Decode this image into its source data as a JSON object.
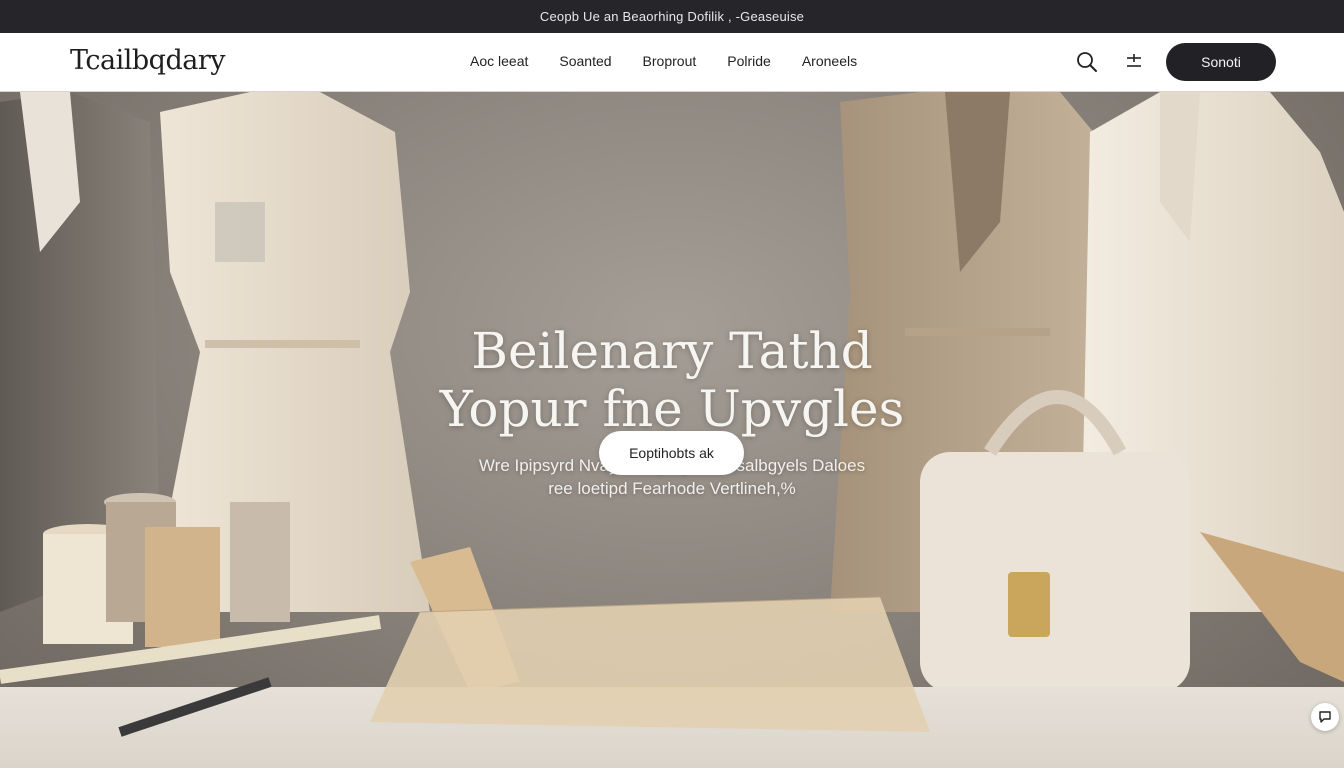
{
  "announcement": "Ceopb Ue an Beaorhing Dofilik , -Geaseuise",
  "brand": {
    "logo": "Tcailbqdary"
  },
  "nav": {
    "items": [
      "Aoc leeat",
      "Soanted",
      "Broprout",
      "Polride",
      "Aroneels"
    ],
    "cta": "Sonoti"
  },
  "icons": {
    "search": "search-icon",
    "filter": "filter-icon",
    "chat": "chat-icon"
  },
  "hero": {
    "headline_line1": "Beilenary Tathd",
    "headline_line2": "Yopur fne Upvgles",
    "sub_line1": "Wre Ipipsyrd Nvayolekdyd yadnd Isalbgyels Daloes",
    "sub_line2": "ree loetipd Fearhode Vertlineh,%",
    "button": "Eoptihobts ak"
  },
  "colors": {
    "topbar": "#25252a",
    "cta": "#222226",
    "hero_text": "#f7f5f2"
  }
}
